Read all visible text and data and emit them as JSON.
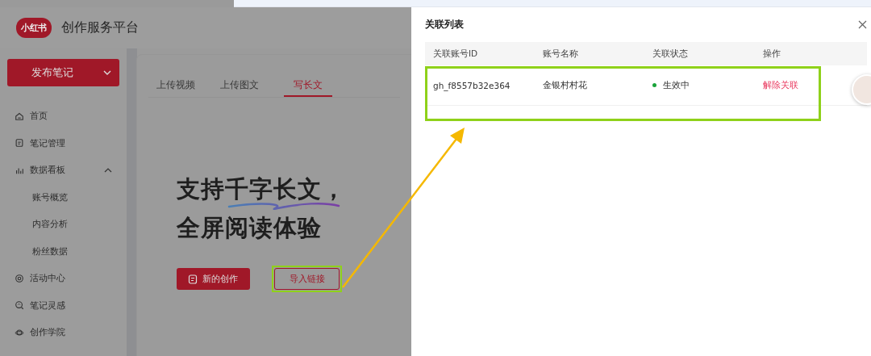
{
  "header": {
    "logo": "小红书",
    "title": "创作服务平台"
  },
  "sidebar": {
    "publish_button": "发布笔记",
    "items": [
      {
        "label": "首页"
      },
      {
        "label": "笔记管理"
      },
      {
        "label": "数据看板",
        "expanded": true,
        "children": [
          {
            "label": "账号概览"
          },
          {
            "label": "内容分析"
          },
          {
            "label": "粉丝数据"
          }
        ]
      },
      {
        "label": "活动中心"
      },
      {
        "label": "笔记灵感"
      },
      {
        "label": "创作学院"
      }
    ]
  },
  "tabs": [
    {
      "label": "上传视频",
      "selected": false
    },
    {
      "label": "上传图文",
      "selected": false
    },
    {
      "label": "写长文",
      "selected": true
    }
  ],
  "hero": {
    "line_1": "支持千字长文，",
    "line_2": "全屏阅读体验"
  },
  "actions": [
    {
      "label": "新的创作",
      "kind": "primary",
      "highlighted": false
    },
    {
      "label": "导入链接",
      "kind": "outline",
      "highlighted": true
    }
  ],
  "drawer": {
    "title": "关联列表",
    "columns": [
      "关联账号ID",
      "账号名称",
      "关联状态",
      "操作"
    ],
    "rows": [
      {
        "account_id": "gh_f8557b32e364",
        "account_name": "金银村村花",
        "status": "生效中",
        "action": "解除关联",
        "highlighted": true
      }
    ]
  }
}
